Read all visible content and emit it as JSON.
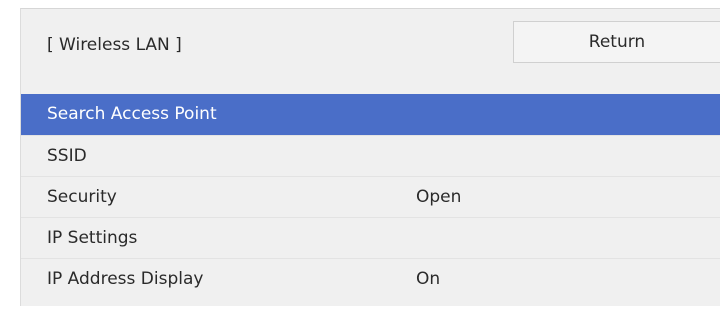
{
  "header": {
    "title": "[ Wireless LAN ]",
    "return_label": "Return"
  },
  "menu": {
    "selected_index": 0,
    "highlight_color": "#4a6ec8",
    "items": [
      {
        "label": "Search Access Point",
        "value": ""
      },
      {
        "label": "SSID",
        "value": ""
      },
      {
        "label": "Security",
        "value": "Open"
      },
      {
        "label": "IP Settings",
        "value": ""
      },
      {
        "label": "IP Address Display",
        "value": "On"
      }
    ]
  }
}
